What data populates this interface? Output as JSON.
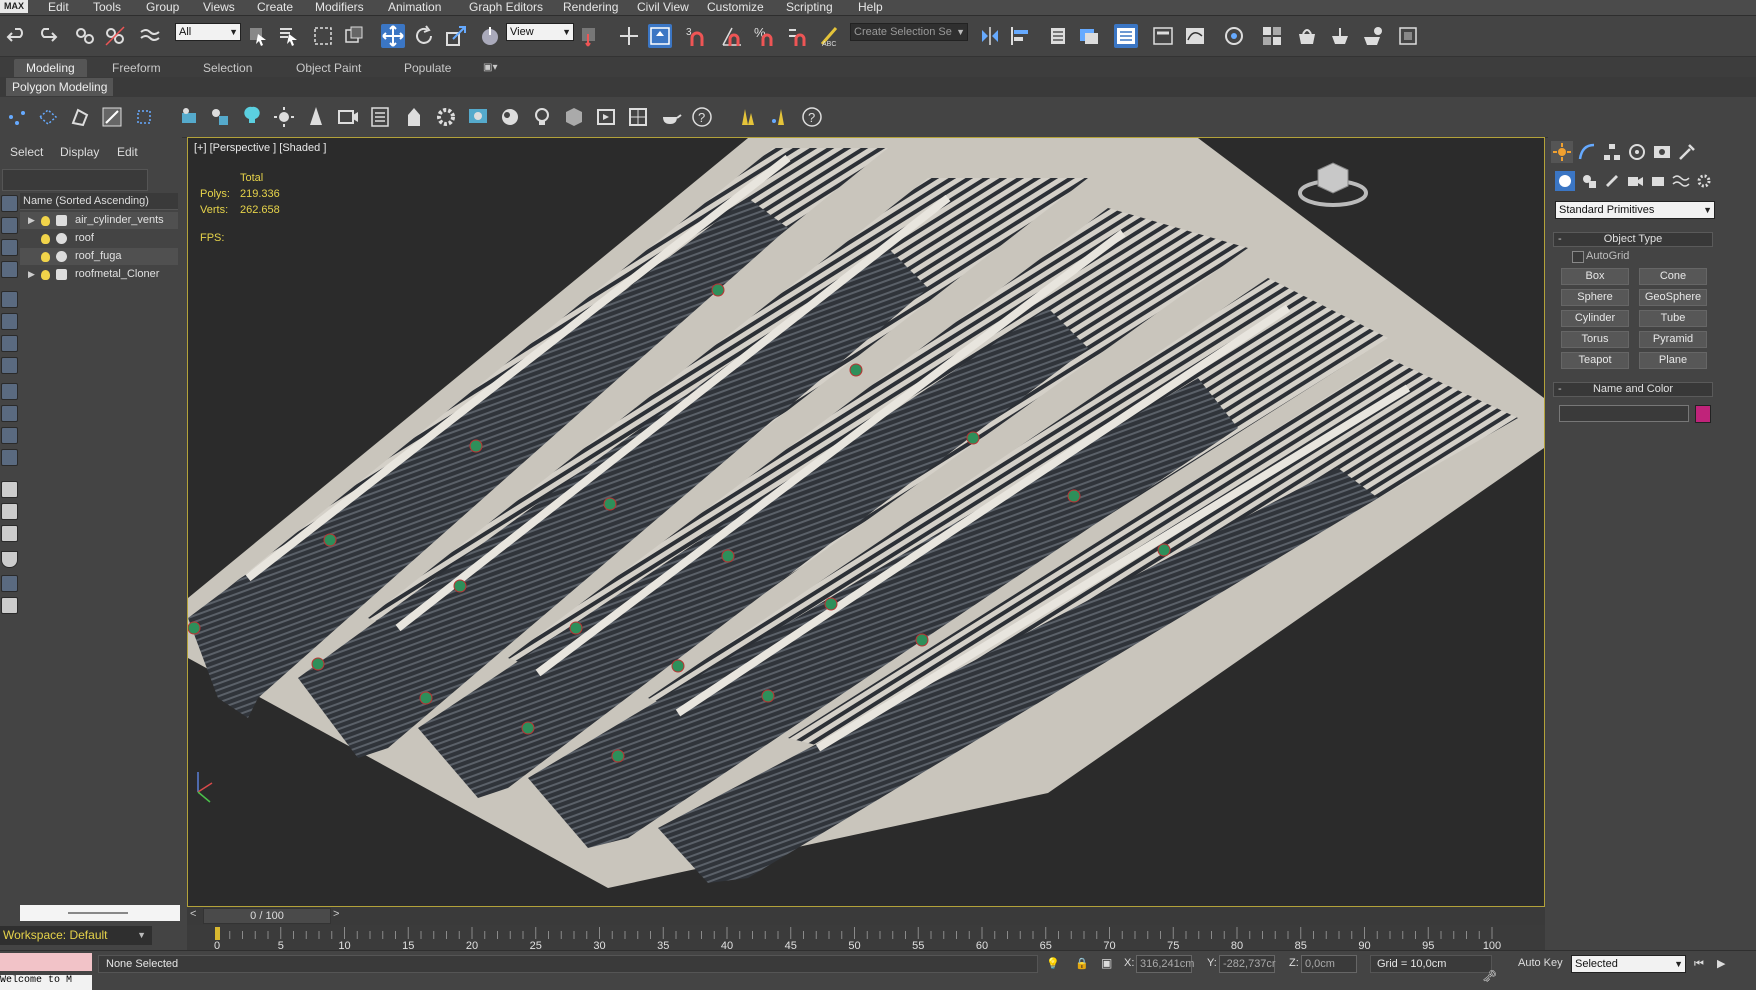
{
  "menubar": {
    "logo": "MAX",
    "items": [
      "Edit",
      "Tools",
      "Group",
      "Views",
      "Create",
      "Modifiers",
      "Animation",
      "Graph Editors",
      "Rendering",
      "Civil View",
      "Customize",
      "Scripting",
      "Help"
    ]
  },
  "toolbar": {
    "selection_filter": "All",
    "reference_coord": "View",
    "named_selection_placeholder": "Create Selection Se",
    "snap_label": "3",
    "percent_label": "%"
  },
  "ribbon": {
    "tabs": [
      "Modeling",
      "Freeform",
      "Selection",
      "Object Paint",
      "Populate"
    ],
    "active_tab": "Modeling",
    "panel_tab": "Polygon Modeling"
  },
  "scene_explorer": {
    "tabs": [
      "Select",
      "Display",
      "Edit"
    ],
    "column_header": "Name (Sorted Ascending)",
    "rows": [
      {
        "name": "air_cylinder_vents",
        "expandable": true,
        "icon": "box-icon"
      },
      {
        "name": "roof",
        "expandable": false,
        "icon": "sphere-icon"
      },
      {
        "name": "roof_fuga",
        "expandable": false,
        "icon": "sphere-icon"
      },
      {
        "name": "roofmetal_Cloner",
        "expandable": true,
        "icon": "box-icon"
      }
    ],
    "workspace": "Workspace: Default"
  },
  "viewport": {
    "label": "[+] [Perspective ] [Shaded ]",
    "stats_title": "Total",
    "polys_label": "Polys:",
    "polys_value": "219.336",
    "verts_label": "Verts:",
    "verts_value": "262.658",
    "fps_label": "FPS:"
  },
  "command_panel": {
    "category": "Standard Primitives",
    "object_type_title": "Object Type",
    "autogrid_label": "AutoGrid",
    "buttons": [
      "Box",
      "Cone",
      "Sphere",
      "GeoSphere",
      "Cylinder",
      "Tube",
      "Torus",
      "Pyramid",
      "Teapot",
      "Plane"
    ],
    "name_color_title": "Name and Color",
    "object_color": "#c0237a"
  },
  "timeline": {
    "frame_display": "0 / 100",
    "ticks": [
      0,
      5,
      10,
      15,
      20,
      25,
      30,
      35,
      40,
      45,
      50,
      55,
      60,
      65,
      70,
      75,
      80,
      85,
      90,
      95,
      100
    ],
    "current_frame": 0
  },
  "status": {
    "selection_text": "None Selected",
    "maxscript_text": "Welcome to M",
    "x_label": "X:",
    "x_value": "316,241cm",
    "y_label": "Y:",
    "y_value": "-282,737cr",
    "z_label": "Z:",
    "z_value": "0,0cm",
    "grid": "Grid = 10,0cm",
    "auto_key": "Auto Key",
    "key_mode": "Selected"
  },
  "colors": {
    "accent_blue": "#3b76c4",
    "viewport_border": "#b3a23a",
    "stats_yellow": "#e6d34a",
    "roof_light": "#c9c5bc",
    "roof_dark": "#3c4148",
    "light_green": "#2e8f5a"
  }
}
